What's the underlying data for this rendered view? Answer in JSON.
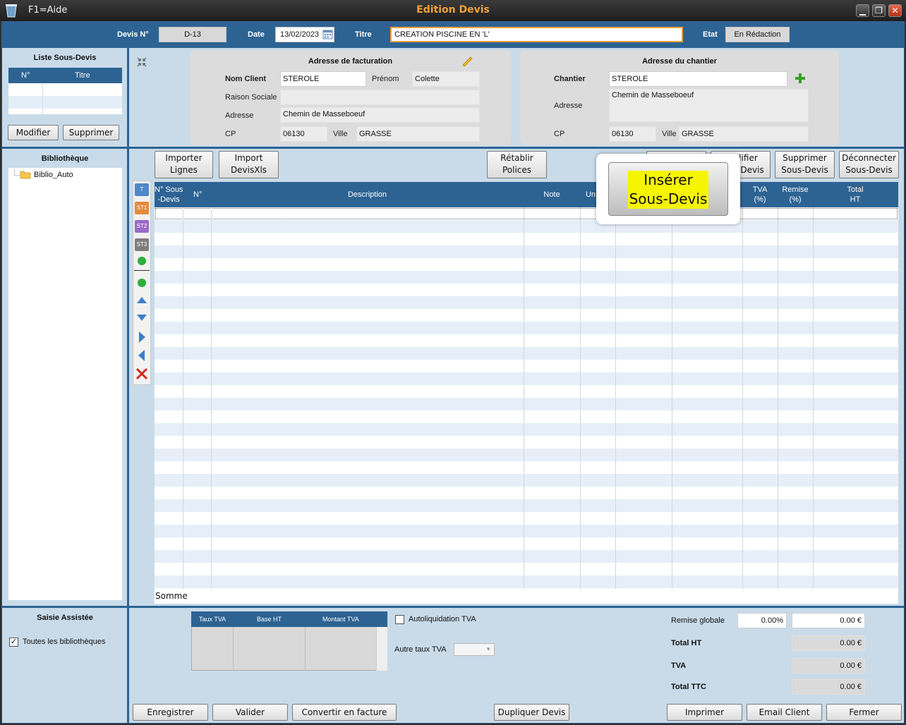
{
  "titlebar": {
    "help": "F1=Aide",
    "title": "Edition Devis",
    "minimize": "▁",
    "maximize": "❐",
    "close": "✕"
  },
  "header": {
    "devis_label": "Devis N°",
    "devis_value": "D-13",
    "date_label": "Date",
    "date_value": "13/02/2023",
    "titre_label": "Titre",
    "titre_value": "CREATION PISCINE EN 'L'",
    "etat_label": "Etat",
    "etat_value": "En Rédaction"
  },
  "sous_devis": {
    "title": "Liste Sous-Devis",
    "columns": [
      "N°",
      "Titre"
    ],
    "modify": "Modifier",
    "delete": "Supprimer"
  },
  "billing": {
    "title": "Adresse de facturation",
    "nom_client_label": "Nom Client",
    "nom_client": "STEROLE",
    "prenom_label": "Prénom",
    "prenom": "Colette",
    "raison_label": "Raison Sociale",
    "raison": "",
    "adresse_label": "Adresse",
    "adresse": "Chemin de Masseboeuf",
    "cp_label": "CP",
    "cp": "06130",
    "ville_label": "Ville",
    "ville": "GRASSE"
  },
  "site": {
    "title": "Adresse du chantier",
    "chantier_label": "Chantier",
    "chantier": "STEROLE",
    "adresse_label": "Adresse",
    "adresse": "Chemin de Masseboeuf",
    "cp_label": "CP",
    "cp": "06130",
    "ville_label": "Ville",
    "ville": "GRASSE"
  },
  "library": {
    "title": "Bibliothèque",
    "item": "Biblio_Auto"
  },
  "toolbar": {
    "importer_1": "Importer",
    "importer_2": "Lignes",
    "import_1": "Import",
    "import_2": "DevisXls",
    "retablir_1": "Rétablir",
    "retablir_2": "Polices",
    "modifier_1": "Modifier",
    "modifier_2": "Sous-Devis",
    "supprimer_1": "Supprimer",
    "supprimer_2": "Sous-Devis",
    "deconnecter_1": "Déconnecter",
    "deconnecter_2": "Sous-Devis"
  },
  "tooltip": {
    "line1": "Insérer",
    "line2": "Sous-Devis"
  },
  "side_tools": {
    "t": "T",
    "st1": "ST1",
    "st2": "ST2",
    "st3": "ST3"
  },
  "grid": {
    "h_sous": "N° Sous\n-Devis",
    "h_num": "N°",
    "h_desc": "Description",
    "h_note": "Note",
    "h_unite": "Un",
    "h_tva": "TVA\n(%)",
    "h_remise": "Remise\n(%)",
    "h_total": "Total\nHT",
    "somme": "Somme"
  },
  "saisie": {
    "title": "Saisie Assistée",
    "all_libraries": "Toutes les bibliothèques"
  },
  "tva_table": {
    "columns": [
      "Taux TVA",
      "Base HT",
      "Montant TVA"
    ],
    "autoliquidation": "Autoliquidation TVA",
    "autre_taux": "Autre taux TVA"
  },
  "totals": {
    "remise_label": "Remise globale",
    "remise_pct": "0.00%",
    "remise_val": "0.00 €",
    "total_ht_label": "Total HT",
    "total_ht": "0.00 €",
    "tva_label": "TVA",
    "tva": "0.00 €",
    "ttc_label": "Total TTC",
    "ttc": "0.00 €"
  },
  "footer": {
    "enregistrer": "Enregistrer",
    "valider": "Valider",
    "convertir": "Convertir en facture",
    "dupliquer": "Dupliquer Devis",
    "imprimer": "Imprimer",
    "email": "Email Client",
    "fermer": "Fermer"
  },
  "colors": {
    "accent": "#2d6393",
    "panel": "#c9dbe9",
    "title_orange": "#f3a13a",
    "tooltip_yellow": "#f5f500"
  }
}
